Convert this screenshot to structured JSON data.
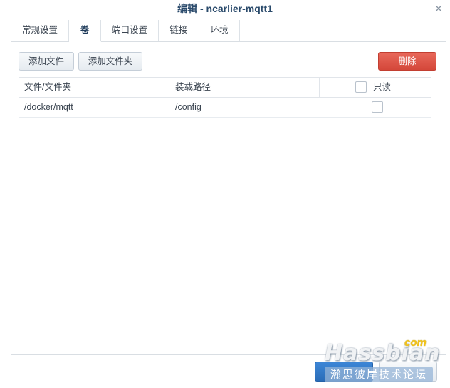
{
  "window": {
    "title": "编辑 - ncarlier-mqtt1",
    "close_icon": "✕"
  },
  "tabs": [
    {
      "label": "常规设置",
      "active": false
    },
    {
      "label": "卷",
      "active": true
    },
    {
      "label": "端口设置",
      "active": false
    },
    {
      "label": "链接",
      "active": false
    },
    {
      "label": "环境",
      "active": false
    }
  ],
  "toolbar": {
    "add_file_label": "添加文件",
    "add_folder_label": "添加文件夹",
    "delete_label": "删除"
  },
  "table": {
    "columns": [
      "文件/文件夹",
      "装载路径",
      "只读"
    ],
    "rows": [
      {
        "file": "/docker/mqtt",
        "mount_path": "/config",
        "read_only": false
      }
    ]
  },
  "watermark": {
    "brand": "Hassbian",
    "suffix": "com",
    "tagline": "瀚思彼岸技术论坛"
  },
  "colors": {
    "accent_blue": "#2a6db8",
    "danger_red": "#d4473a",
    "title_text": "#2a4a6b"
  }
}
